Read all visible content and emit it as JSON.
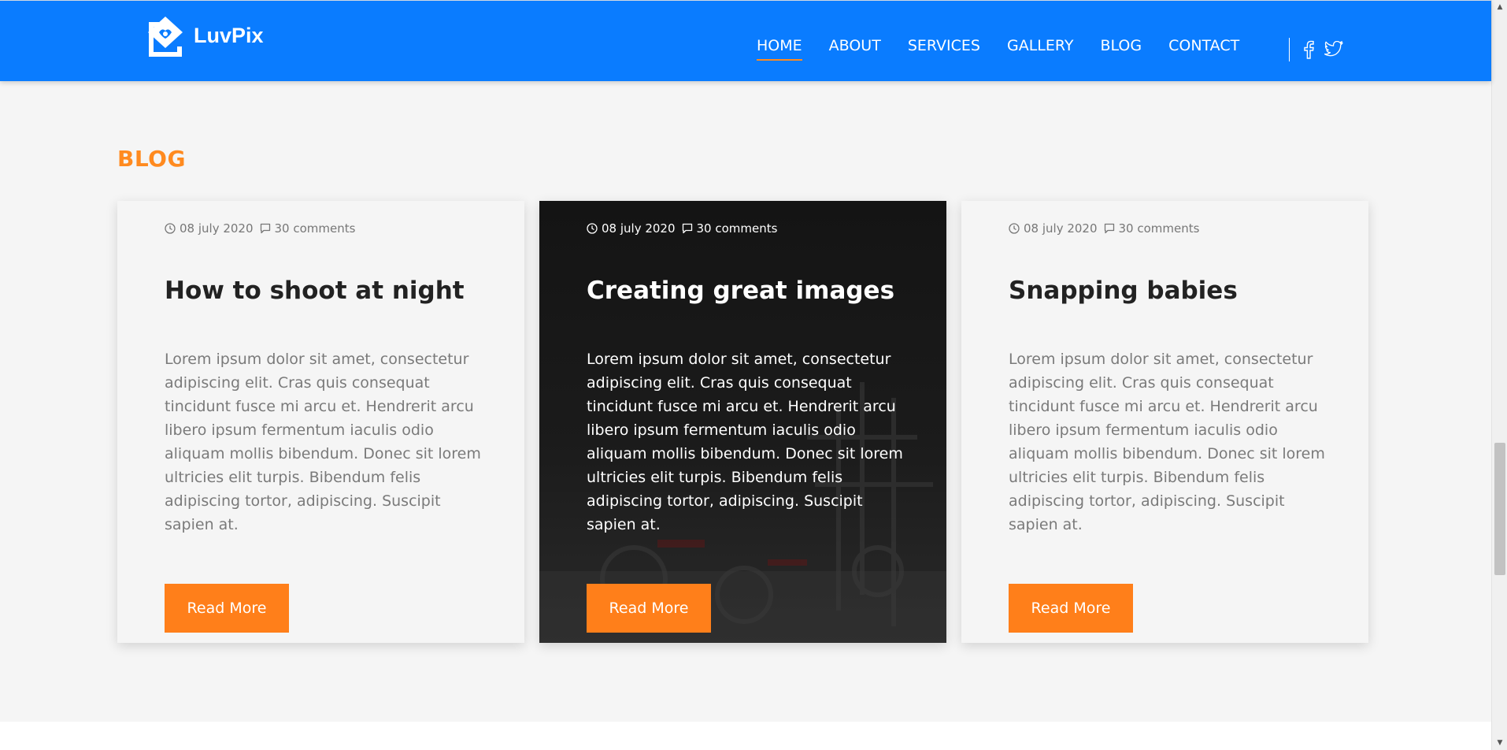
{
  "header": {
    "logo_text": "LuvPix",
    "nav": [
      {
        "label": "HOME",
        "active": true
      },
      {
        "label": "ABOUT",
        "active": false
      },
      {
        "label": "SERVICES",
        "active": false
      },
      {
        "label": "GALLERY",
        "active": false
      },
      {
        "label": "BLOG",
        "active": false
      },
      {
        "label": "CONTACT",
        "active": false
      }
    ],
    "social": [
      "facebook-icon",
      "twitter-icon"
    ]
  },
  "section": {
    "title": "BLOG"
  },
  "posts": [
    {
      "date": "08 july 2020",
      "comments": "30 comments",
      "title": "How to shoot at night",
      "body": "Lorem ipsum dolor sit amet, consectetur adipiscing elit. Cras quis consequat tincidunt fusce mi arcu et. Hendrerit arcu libero ipsum fermentum iaculis odio aliquam mollis bibendum. Donec sit lorem ultricies elit turpis. Bibendum felis adipiscing tortor, adipiscing. Suscipit sapien at.",
      "button": "Read More",
      "theme": "light"
    },
    {
      "date": "08 july 2020",
      "comments": "30 comments",
      "title": "Creating great images",
      "body": "Lorem ipsum dolor sit amet, consectetur adipiscing elit. Cras quis consequat tincidunt fusce mi arcu et. Hendrerit arcu libero ipsum fermentum iaculis odio aliquam mollis bibendum. Donec sit lorem ultricies elit turpis. Bibendum felis adipiscing tortor, adipiscing. Suscipit sapien at.",
      "button": "Read More",
      "theme": "dark"
    },
    {
      "date": "08 july 2020",
      "comments": "30 comments",
      "title": "Snapping babies",
      "body": "Lorem ipsum dolor sit amet, consectetur adipiscing elit. Cras quis consequat tincidunt fusce mi arcu et. Hendrerit arcu libero ipsum fermentum iaculis odio aliquam mollis bibendum. Donec sit lorem ultricies elit turpis. Bibendum felis adipiscing tortor, adipiscing. Suscipit sapien at.",
      "button": "Read More",
      "theme": "light"
    }
  ],
  "colors": {
    "header_bg": "#0a7cff",
    "accent": "#ff7f1a",
    "page_bg": "#f5f5f5",
    "dark_card_bg": "#161616"
  }
}
